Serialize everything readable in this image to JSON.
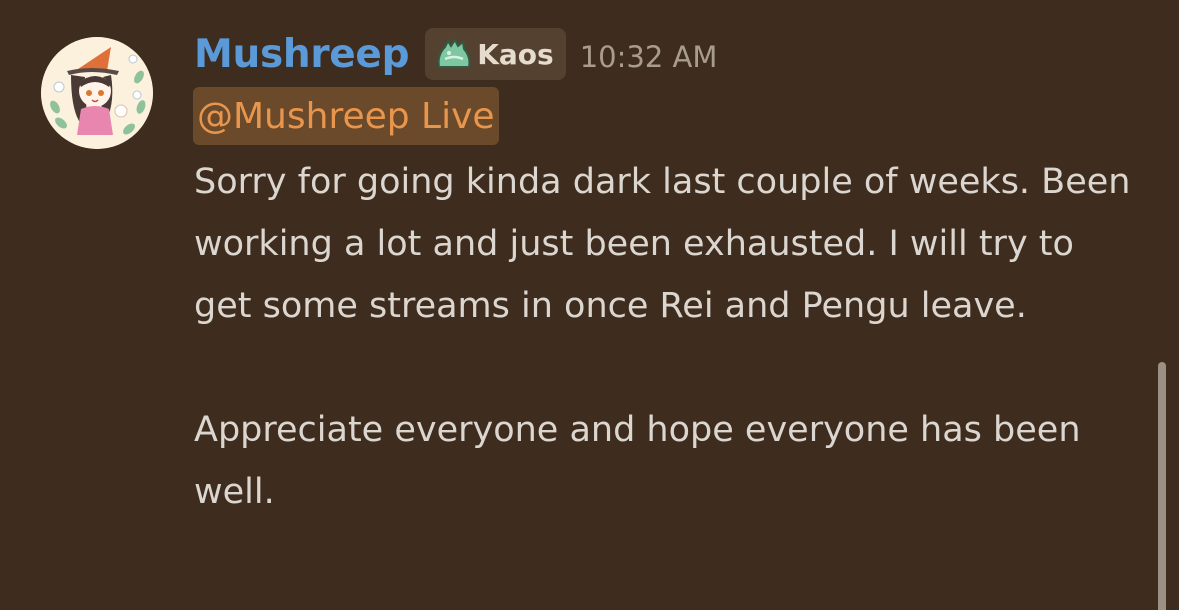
{
  "message": {
    "author": {
      "name": "Mushreep",
      "name_color": "#5b9ad8",
      "avatar_icon": "witch-girl-avatar"
    },
    "role": {
      "icon": "green-slime-icon",
      "name": "Kaos"
    },
    "timestamp": "10:32 AM",
    "mention": {
      "text": "@Mushreep Live",
      "color": "#e8954d"
    },
    "paragraphs": [
      "Sorry for going kinda dark last couple of weeks. Been working a lot and just been exhausted. I will try to get some streams in once Rei and Pengu leave.",
      "Appreciate everyone and hope everyone has been well."
    ]
  },
  "colors": {
    "background": "#3e2d1e",
    "text": "#dcd6d0",
    "timestamp": "#a89c8c"
  }
}
